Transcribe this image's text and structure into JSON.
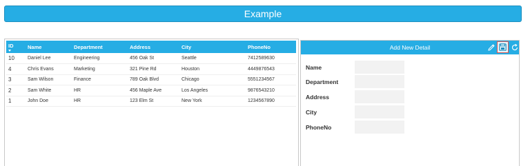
{
  "header": {
    "title": "Example"
  },
  "grid": {
    "columns": [
      "ID",
      "Name",
      "Department",
      "Address",
      "City",
      "PhoneNo"
    ],
    "rows": [
      [
        "10",
        "Daniel Lee",
        "Engineering",
        "456 Oak St",
        "Seattle",
        "7412589630"
      ],
      [
        "4",
        "Chris Evans",
        "Marketing",
        "321 Pine Rd",
        "Houston",
        "4449876543"
      ],
      [
        "3",
        "Sam Wilson",
        "Finance",
        "789 Oak Blvd",
        "Chicago",
        "5551234567"
      ],
      [
        "2",
        "Sam White",
        "HR",
        "456 Maple Ave",
        "Los Angeles",
        "9876543210"
      ],
      [
        "1",
        "John Doe",
        "HR",
        "123 Elm St",
        "New York",
        "1234567890"
      ]
    ]
  },
  "form": {
    "title": "Add New Detail",
    "fields": [
      {
        "label": "Name",
        "value": ""
      },
      {
        "label": "Department",
        "value": ""
      },
      {
        "label": "Address",
        "value": ""
      },
      {
        "label": "City",
        "value": ""
      },
      {
        "label": "PhoneNo",
        "value": ""
      }
    ]
  },
  "colors": {
    "accent": "#26ade4",
    "highlight": "#d9534f"
  },
  "icons": {
    "edit": "pencil-icon",
    "save": "save-icon",
    "refresh": "refresh-icon",
    "sort": "sort-descending-icon"
  }
}
